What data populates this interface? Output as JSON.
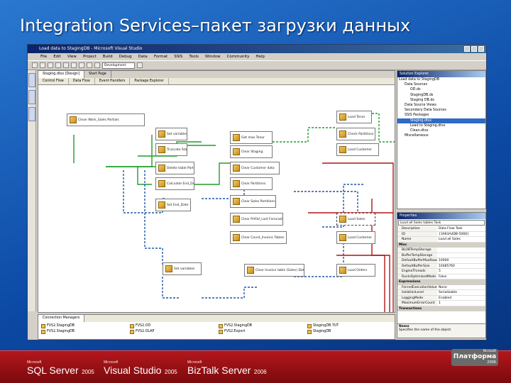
{
  "slide": {
    "title": "Integration Services–пакет загрузки данных",
    "colors": {
      "background": "#0c4aa5",
      "footer": "#9b1015"
    }
  },
  "window": {
    "title": "Load data to StagingDB - Microsoft Visual Studio",
    "menu": [
      "File",
      "Edit",
      "View",
      "Project",
      "Build",
      "Debug",
      "Data",
      "Format",
      "SSIS",
      "Tools",
      "Window",
      "Community",
      "Help"
    ],
    "toolbar": {
      "config": "Development"
    }
  },
  "designer": {
    "doc_tabs": [
      "Staging.dtsx [Design]",
      "Start Page"
    ],
    "designer_tabs": [
      "Control Flow",
      "Data Flow",
      "Event Handlers",
      "Package Explorer"
    ],
    "tasks": [
      {
        "label": "Clean Work_Sales Partials"
      },
      {
        "label": "Set variables"
      },
      {
        "label": "Truncate Staging tables"
      },
      {
        "label": "Get max Tenor"
      },
      {
        "label": "Clear Staging"
      },
      {
        "label": "Load Tenor"
      },
      {
        "label": "Check Partitions"
      },
      {
        "label": "Load Customer"
      },
      {
        "label": "Clear Customer data"
      },
      {
        "label": "Delete table PartComm"
      },
      {
        "label": "Clear Partitions"
      },
      {
        "label": "Calculate End_Date"
      },
      {
        "label": "Clear Sales Partitions"
      },
      {
        "label": "Set End_Date"
      },
      {
        "label": "Clear PrtFaf_Last Forecast"
      },
      {
        "label": "Load Sales"
      },
      {
        "label": "Clear Count_Invoice Tables"
      },
      {
        "label": "Load Customer"
      },
      {
        "label": "Set variables"
      },
      {
        "label": "Clear Invoice table (Sales) Data"
      },
      {
        "label": "Load Orders"
      }
    ]
  },
  "solution": {
    "title": "Solution Explorer",
    "items": [
      {
        "label": "Load data to StagingDB"
      },
      {
        "label": "Data Sources"
      },
      {
        "label": "OD.ds"
      },
      {
        "label": "StagingDB.ds"
      },
      {
        "label": "Staging DB.ds"
      },
      {
        "label": "Data Source Views"
      },
      {
        "label": "Secondary Data Sources"
      },
      {
        "label": "SSIS Packages"
      },
      {
        "label": "Staging.dtsx"
      },
      {
        "label": "Load to Staging.dtsx"
      },
      {
        "label": "Clean.dtsx"
      },
      {
        "label": "Miscellaneous"
      }
    ]
  },
  "properties": {
    "title": "Properties",
    "selected": "Load all Sales tables Task",
    "rows": [
      {
        "key": "Description",
        "value": "Data Flow Task"
      },
      {
        "key": "ID",
        "value": "{3A63A4DB-5066}"
      },
      {
        "key": "Name",
        "value": "Load all Sales"
      }
    ],
    "groups": [
      {
        "label": "Misc",
        "rows": [
          {
            "key": "BLOBTempStorage",
            "value": ""
          },
          {
            "key": "BufferTempStorage",
            "value": ""
          },
          {
            "key": "DefaultBufferMaxRows",
            "value": "10000"
          },
          {
            "key": "DefaultBufferSize",
            "value": "10485760"
          },
          {
            "key": "EngineThreads",
            "value": "5"
          },
          {
            "key": "RunInOptimizedMode",
            "value": "False"
          }
        ]
      },
      {
        "label": "Expressions",
        "rows": [
          {
            "key": "ForcedExecutionValue",
            "value": "None"
          },
          {
            "key": "IsolationLevel",
            "value": "Serializable"
          },
          {
            "key": "LoggingMode",
            "value": "Enabled"
          },
          {
            "key": "MaximumErrorCount",
            "value": "1"
          }
        ]
      },
      {
        "label": "Transactions",
        "rows": []
      }
    ],
    "desc_title": "Name",
    "desc_text": "Specifies the name of the object."
  },
  "connections": {
    "title": "Connection Managers",
    "items": [
      {
        "label": "FVS2.StagingDB"
      },
      {
        "label": "FVS2.OD"
      },
      {
        "label": "FVS2.StagingDB"
      },
      {
        "label": "StagingDB.TUT"
      },
      {
        "label": "FVS2.StagingDB"
      },
      {
        "label": "FVS2.OLAP"
      },
      {
        "label": "FVS2.Export"
      },
      {
        "label": "StagingDB"
      }
    ]
  },
  "footer": {
    "products": [
      {
        "maker": "Microsoft",
        "name": "SQL Server",
        "year": "2005"
      },
      {
        "maker": "Microsoft",
        "name": "Visual Studio",
        "year": "2005"
      },
      {
        "maker": "Microsoft",
        "name": "BizTalk Server",
        "year": "2006"
      }
    ],
    "platform": {
      "maker": "Microsoft",
      "name": "Платформа",
      "year": "2006"
    }
  }
}
